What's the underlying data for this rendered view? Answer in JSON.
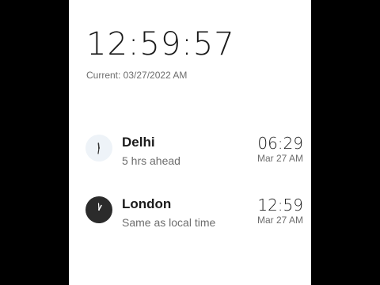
{
  "main_clock": {
    "time": "12:59:57",
    "current_label": "Current: 03/27/2022 AM"
  },
  "world_clocks": [
    {
      "city": "Delhi",
      "difference": "5 hrs ahead",
      "time": "06:29",
      "date": "Mar 27 AM",
      "icon": "analog-clock-icon",
      "dial_color": "#eef3f8"
    },
    {
      "city": "London",
      "difference": "Same as local time",
      "time": "12:59",
      "date": "Mar 27 AM",
      "icon": "analog-clock-icon",
      "dial_color": "#2b2b2b"
    }
  ]
}
